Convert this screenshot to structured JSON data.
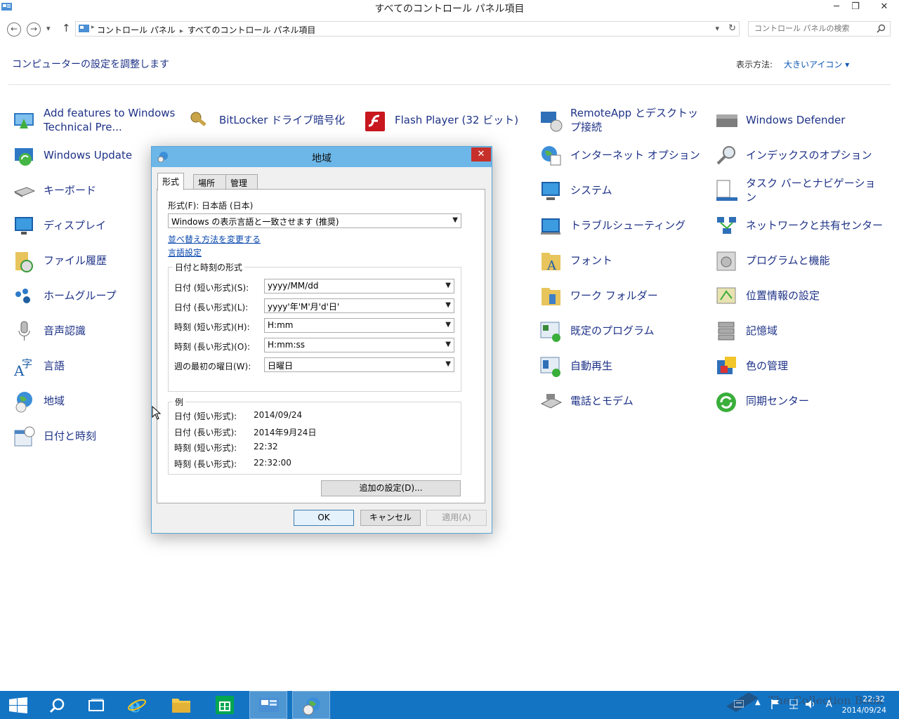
{
  "window": {
    "title": "すべてのコントロール パネル項目",
    "minimize": "─",
    "restore": "❐",
    "close": "✕"
  },
  "address": {
    "back": "←",
    "forward": "→",
    "up": "↑",
    "dropdown": "▾",
    "refresh": "↻",
    "crumbs": [
      "コントロール パネル",
      "すべてのコントロール パネル項目"
    ],
    "crumb_sep": "▸",
    "search_placeholder": "コントロール パネルの検索"
  },
  "header": {
    "title": "コンピューターの設定を調整します",
    "view_label": "表示方法:",
    "view_value": "大きいアイコン ▾"
  },
  "items": {
    "add_features": "Add features to Windows Technical Pre...",
    "windows_update": "Windows Update",
    "keyboard": "キーボード",
    "display": "ディスプレイ",
    "file_history": "ファイル履歴",
    "homegroup": "ホームグループ",
    "speech": "音声認識",
    "language": "言語",
    "region": "地域",
    "datetime": "日付と時刻",
    "bitlocker": "BitLocker ドライブ暗号化",
    "flash": "Flash Player (32 ビット)",
    "remoteapp": "RemoteApp とデスクトップ接続",
    "internet_options": "インターネット オプション",
    "system": "システム",
    "troubleshooting": "トラブルシューティング",
    "fonts": "フォント",
    "work_folders": "ワーク フォルダー",
    "default_programs": "既定のプログラム",
    "autoplay": "自動再生",
    "phone_modem": "電話とモデム",
    "defender": "Windows Defender",
    "indexing": "インデックスのオプション",
    "taskbar_nav": "タスク バーとナビゲーション",
    "network_center": "ネットワークと共有センター",
    "programs_features": "プログラムと機能",
    "location": "位置情報の設定",
    "storage_spaces": "記憶域",
    "color_mgmt": "色の管理",
    "sync_center": "同期センター"
  },
  "dialog": {
    "title": "地域",
    "close": "✕",
    "tabs": [
      "形式",
      "場所",
      "管理"
    ],
    "format_label": "形式(F): 日本語 (日本)",
    "format_value": "Windows の表示言語と一致させます (推奨)",
    "link_sort": "並べ替え方法を変更する",
    "link_language": "言語設定",
    "group_datetime": "日付と時刻の形式",
    "rows": [
      {
        "label": "日付 (短い形式)(S):",
        "value": "yyyy/MM/dd"
      },
      {
        "label": "日付 (長い形式)(L):",
        "value": "yyyy'年'M'月'd'日'"
      },
      {
        "label": "時刻 (短い形式)(H):",
        "value": "H:mm"
      },
      {
        "label": "時刻 (長い形式)(O):",
        "value": "H:mm:ss"
      },
      {
        "label": "週の最初の曜日(W):",
        "value": "日曜日"
      }
    ],
    "group_example": "例",
    "examples": [
      {
        "label": "日付 (短い形式):",
        "value": "2014/09/24"
      },
      {
        "label": "日付 (長い形式):",
        "value": "2014年9月24日"
      },
      {
        "label": "時刻 (短い形式):",
        "value": "22:32"
      },
      {
        "label": "時刻 (長い形式):",
        "value": "22:32:00"
      }
    ],
    "additional": "追加の設定(D)...",
    "ok": "OK",
    "cancel": "キャンセル",
    "apply": "適用(A)"
  },
  "taskbar": {
    "time": "22:32",
    "date": "2014/09/24",
    "ime": "A"
  },
  "watermark": "The Collection Book"
}
